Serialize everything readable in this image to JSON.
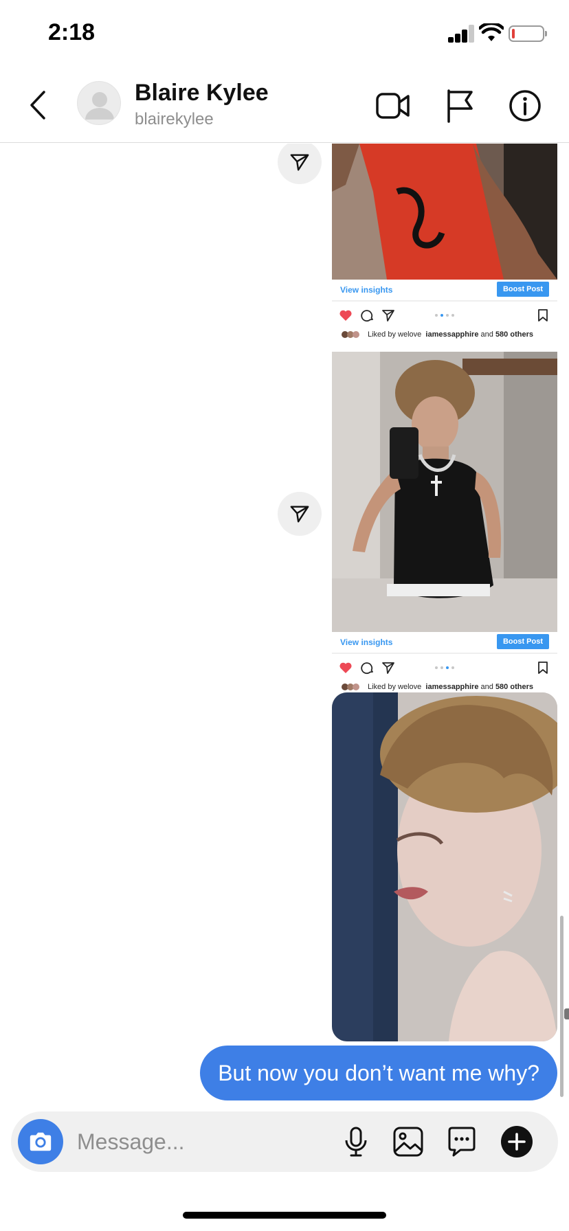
{
  "status": {
    "time": "2:18",
    "battery_color": "#e0403a"
  },
  "header": {
    "back_icon": "chevron-left-icon",
    "name": "Blaire Kylee",
    "username": "blairekylee",
    "icons": [
      "video-camera-icon",
      "flag-icon",
      "info-icon"
    ]
  },
  "posts": [
    {
      "view_insights": "View insights",
      "boost": "Boost Post",
      "liked_prefix": "Liked by welove",
      "liked_user": "iamessapphire",
      "liked_and": "and",
      "liked_others": "580 others",
      "carousel_active_dot": 2
    },
    {
      "view_insights": "View insights",
      "boost": "Boost Post",
      "liked_prefix": "Liked by welove",
      "liked_user": "iamessapphire",
      "liked_and": "and",
      "liked_others": "580 others",
      "carousel_active_dot": 3
    }
  ],
  "message_bubble": {
    "text": "But now you don’t want me why?",
    "color": "#3e7fe6"
  },
  "composer": {
    "placeholder": "Message...",
    "icons": [
      "camera-icon",
      "microphone-icon",
      "gallery-icon",
      "sticker-chat-icon",
      "plus-icon"
    ]
  }
}
